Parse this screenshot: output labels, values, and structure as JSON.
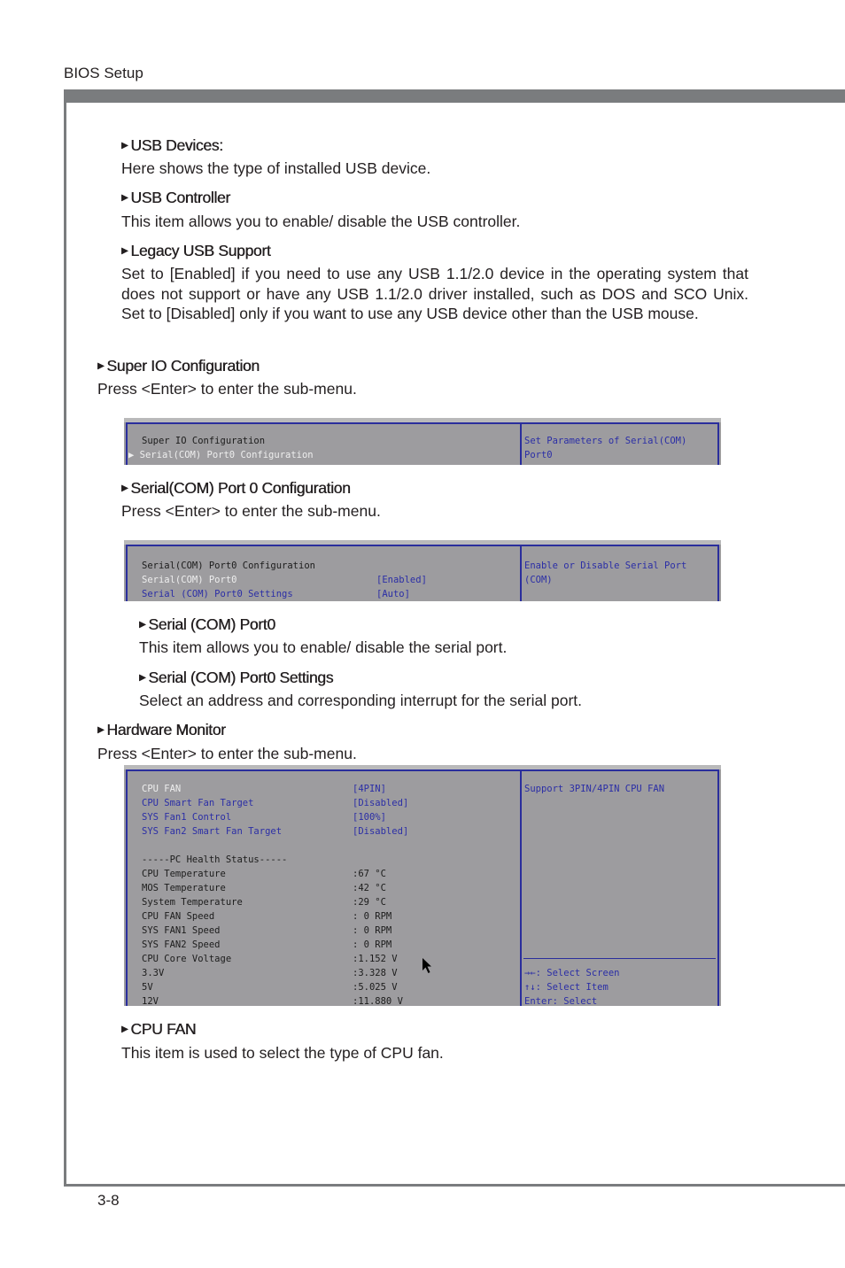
{
  "header": {
    "title": "BIOS Setup"
  },
  "footer": {
    "page_number": "3-8"
  },
  "sections": {
    "usb_devices": {
      "title": "USB Devices:",
      "desc": "Here shows the type of installed USB device."
    },
    "usb_controller": {
      "title": "USB Controller",
      "desc": "This item allows you to enable/ disable the USB controller."
    },
    "legacy_usb": {
      "title": "Legacy USB Support",
      "desc": "Set to [Enabled] if you need to use any USB 1.1/2.0 device in the operating system that does not support or have any USB 1.1/2.0 driver installed, such as DOS and SCO Unix. Set to [Disabled] only if you want to use any USB device other than the USB mouse."
    },
    "super_io": {
      "title": "Super IO Configuration",
      "desc": "Press <Enter> to enter the sub-menu."
    },
    "serial_cfg": {
      "title": "Serial(COM) Port 0 Configuration",
      "desc": "Press <Enter> to enter the sub-menu."
    },
    "serial_port0": {
      "title": "Serial (COM) Port0",
      "desc": "This item allows you to enable/ disable the serial port."
    },
    "serial_settings": {
      "title": "Serial (COM) Port0 Settings",
      "desc": "Select an address and corresponding interrupt for the serial port."
    },
    "hw_monitor": {
      "title": "Hardware Monitor",
      "desc": "Press <Enter> to enter the sub-menu."
    },
    "cpu_fan": {
      "title": "CPU FAN",
      "desc": "This item is used to select the type of CPU fan."
    }
  },
  "screen1": {
    "title": "Super IO Configuration",
    "item": "Serial(COM) Port0 Configuration",
    "help_line1": "Set Parameters of Serial(COM)",
    "help_line2": "Port0"
  },
  "screen2": {
    "title": "Serial(COM) Port0 Configuration",
    "items": [
      {
        "label": "Serial(COM) Port0",
        "value": "[Enabled]"
      },
      {
        "label": "Serial (COM) Port0 Settings",
        "value": "[Auto]"
      }
    ],
    "help_line1": "Enable or Disable Serial Port",
    "help_line2": "(COM)"
  },
  "screen3": {
    "settings": [
      {
        "label": "CPU FAN",
        "value": "[4PIN]"
      },
      {
        "label": "CPU Smart Fan Target",
        "value": "[Disabled]"
      },
      {
        "label": "SYS Fan1 Control",
        "value": "[100%]"
      },
      {
        "label": "SYS Fan2 Smart Fan Target",
        "value": "[Disabled]"
      }
    ],
    "status_heading": "-----PC Health Status-----",
    "status": [
      {
        "label": "CPU Temperature",
        "value": ":67 °C"
      },
      {
        "label": "MOS Temperature",
        "value": ":42 °C"
      },
      {
        "label": "System Temperature",
        "value": ":29 °C"
      },
      {
        "label": "CPU FAN Speed",
        "value": ": 0 RPM"
      },
      {
        "label": "SYS FAN1 Speed",
        "value": ": 0 RPM"
      },
      {
        "label": "SYS FAN2 Speed",
        "value": ": 0 RPM"
      },
      {
        "label": "CPU Core Voltage",
        "value": ":1.152 V"
      },
      {
        "label": "3.3V",
        "value": ":3.328 V"
      },
      {
        "label": "5V",
        "value": ":5.025 V"
      },
      {
        "label": "12V",
        "value": ":11.880 V"
      }
    ],
    "help": "Support 3PIN/4PIN CPU FAN",
    "keys": [
      "→←: Select Screen",
      "↑↓: Select Item",
      "Enter: Select"
    ]
  }
}
